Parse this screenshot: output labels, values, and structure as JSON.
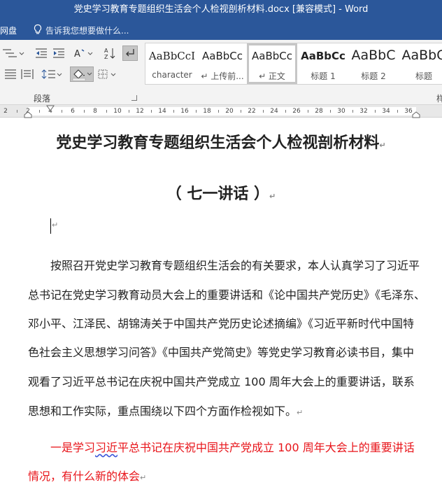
{
  "window": {
    "title": "党史学习教育专题组织生活会个人检视剖析材料.docx [兼容模式] - Word"
  },
  "tellbar": {
    "wangpan": "网盘",
    "tell_me": "告诉我您想要做什么..."
  },
  "ribbon": {
    "group_label": "段落",
    "right_group_label_stub": "样",
    "styles": [
      {
        "sample": "AaBbCcI",
        "name": "character",
        "selected": false
      },
      {
        "sample": "AaBbCc",
        "name": "↵ 上传前...",
        "selected": false
      },
      {
        "sample": "AaBbCc",
        "name": "↵ 正文",
        "selected": true
      },
      {
        "sample": "AaBbCc",
        "name": "标题 1",
        "selected": false
      },
      {
        "sample": "AaBbC",
        "name": "标题 2",
        "selected": false
      },
      {
        "sample": "AaBbC",
        "name": "标题",
        "selected": false
      }
    ]
  },
  "ruler": {
    "labels": [
      "2",
      "2",
      "4",
      "6",
      "8",
      "10",
      "12",
      "14",
      "16",
      "18",
      "20",
      "22",
      "24",
      "26",
      "28",
      "30",
      "32",
      "34",
      "36"
    ]
  },
  "document": {
    "title": "党史学习教育专题组织生活会个人检视剖析材料",
    "subtitle": "（ 七一讲话 ）",
    "paragraph_mark": "↵",
    "body_lines": [
      "按照召开党史学习教育专题组织生活会的有关要求，本人认真学习了习近平",
      "总书记在党史学习教育动员大会上的重要讲话和《论中国共产党历史》《毛泽东、",
      "邓小平、江泽民、胡锦涛关于中国共产党历史论述摘编》《习近平新时代中国特",
      "色社会主义思想学习问答》《中国共产党简史》等党史学习教育必读书目，集中",
      "观看了习近平总书记在庆祝中国共产党成立 100 周年大会上的重要讲话，联系",
      "思想和工作实际，重点围绕以下四个方面作检视如下。"
    ],
    "red_heading_prefix": "一是学习",
    "red_heading_underlined": "习近",
    "red_heading_line1_rest": "平总书记在庆祝中国共产党成立 100 周年大会上的重要讲话",
    "red_heading_line2": "情况，有什么新的体会"
  },
  "colors": {
    "titlebar_bg": "#2b579a",
    "heading_red": "#e8141a",
    "spell_underline": "#3b55d8"
  }
}
